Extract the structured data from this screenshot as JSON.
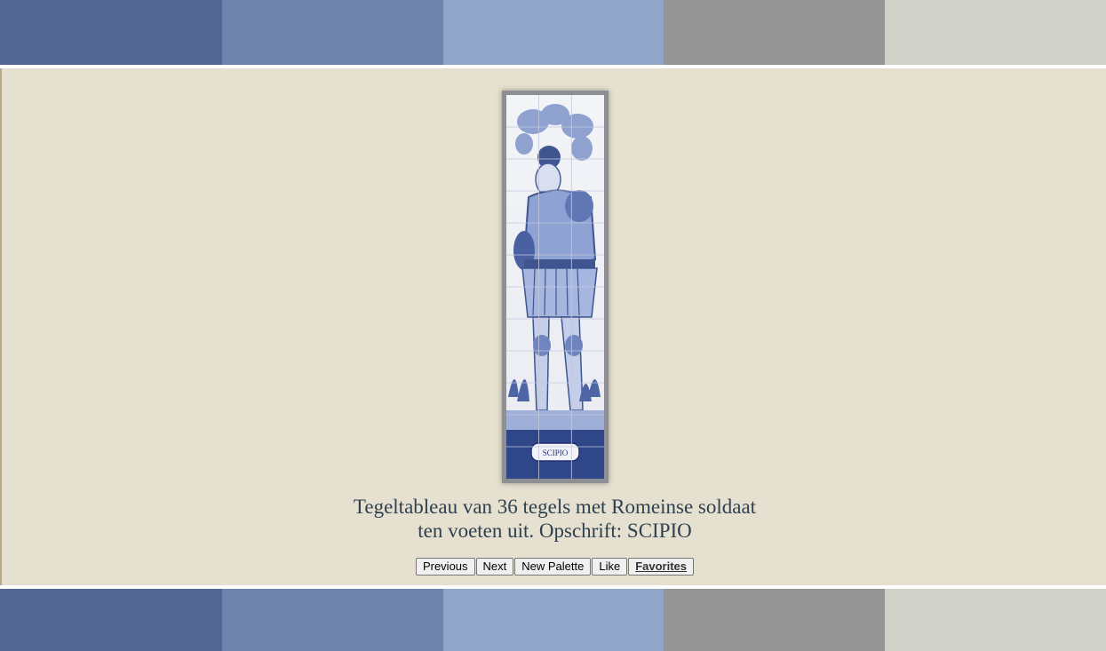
{
  "palette": {
    "colors": [
      "#536593",
      "#7083ad",
      "#90a5c7",
      "#959595",
      "#d0d1c8"
    ]
  },
  "artwork": {
    "image_description_icon": "delft-tile-tableau-roman-soldier",
    "inscription": "SCIPIO"
  },
  "caption": {
    "line1": "Tegeltableau van 36 tegels met Romeinse soldaat",
    "line2": "ten voeten uit. Opschrift: SCIPIO"
  },
  "buttons": {
    "previous": "Previous",
    "next": "Next",
    "new_palette": "New Palette",
    "like": "Like",
    "favorites": "Favorites"
  }
}
